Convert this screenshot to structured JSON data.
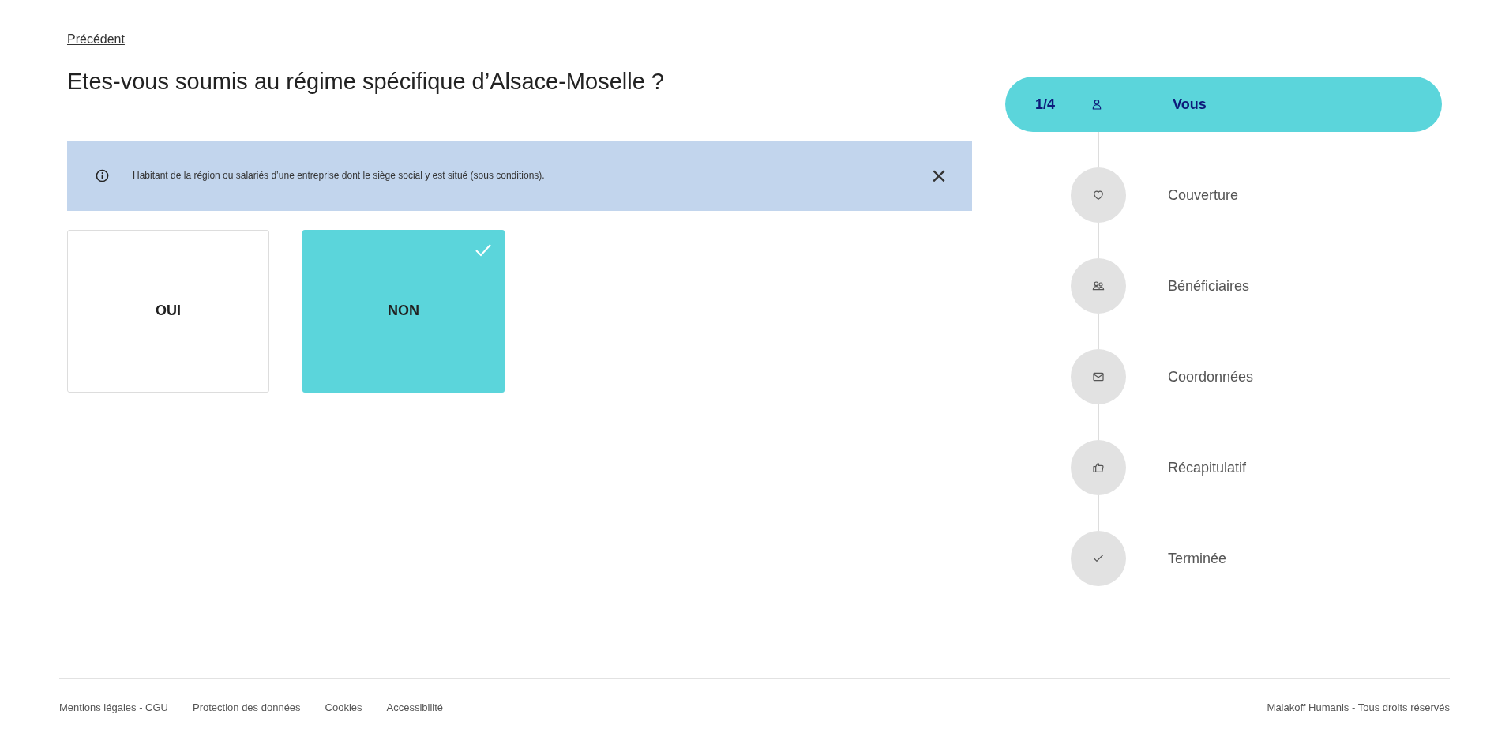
{
  "back_link": "Précédent",
  "question": "Etes-vous soumis au régime spécifique d’Alsace-Moselle ?",
  "info": {
    "text": "Habitant de la région ou salariés d’une entreprise dont le siège social y est situé (sous conditions).",
    "close": "×"
  },
  "choices": [
    {
      "label": "OUI",
      "selected": false
    },
    {
      "label": "NON",
      "selected": true
    }
  ],
  "stepper": {
    "counter": "1/4",
    "steps": [
      {
        "label": "Vous",
        "selected": true
      },
      {
        "label": "Couverture",
        "selected": false
      },
      {
        "label": "Bénéficiaires",
        "selected": false
      },
      {
        "label": "Coordonnées",
        "selected": false
      },
      {
        "label": "Récapitulatif",
        "selected": false
      },
      {
        "label": "Terminée",
        "selected": false
      }
    ]
  },
  "footer": {
    "links": [
      "Mentions légales - CGU",
      "Protection des données",
      "Cookies",
      "Accessibilité"
    ],
    "copyright": "Malakoff Humanis - Tous droits réservés"
  }
}
